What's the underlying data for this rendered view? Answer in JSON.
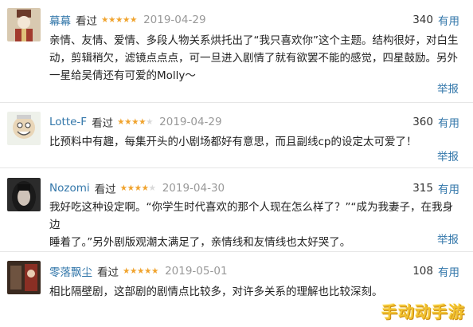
{
  "colors": {
    "link": "#3377aa",
    "star": "#f0a32d",
    "date": "#999999",
    "watermark": "#f2c12e"
  },
  "reviews": [
    {
      "author": "幕幕",
      "watched_label": "看过",
      "rating": 5,
      "date": "2019-04-29",
      "useful_count": "340",
      "useful_label": "有用",
      "lines": [
        "亲情、友情、爱情、多段人物关系烘托出了“我只喜欢你”这个主题。结构很好，对白生",
        "动，剪辑稍欠，滤镜点点点，可一旦进入剧情了就有欲罢不能的感觉，四星鼓励。另外",
        "一星给吴倩还有可爱的Molly～"
      ],
      "report_label": "举报"
    },
    {
      "author": "Lotte-F",
      "watched_label": "看过",
      "rating": 4,
      "date": "2019-04-29",
      "useful_count": "360",
      "useful_label": "有用",
      "lines": [
        "比预料中有趣，每集开头的小剧场都好有意思，而且副线cp的设定太可爱了！"
      ],
      "report_label": "举报"
    },
    {
      "author": "Nozomi",
      "watched_label": "看过",
      "rating": 4,
      "date": "2019-04-30",
      "useful_count": "315",
      "useful_label": "有用",
      "lines": [
        "我好吃这种设定啊。“你学生时代喜欢的那个人现在怎么样了？”“成为我妻子，在我身边",
        "睡着了。”另外剧版观潮太满足了，亲情线和友情线也太好哭了。"
      ],
      "report_label": "举报"
    },
    {
      "author": "零落飘尘",
      "watched_label": "看过",
      "rating": 5,
      "date": "2019-05-01",
      "useful_count": "108",
      "useful_label": "有用",
      "lines": [
        "相比隔壁剧，这部剧的剧情点比较多，对许多关系的理解也比较深刻。"
      ],
      "report_label": ""
    }
  ],
  "watermark": "手动动手游"
}
